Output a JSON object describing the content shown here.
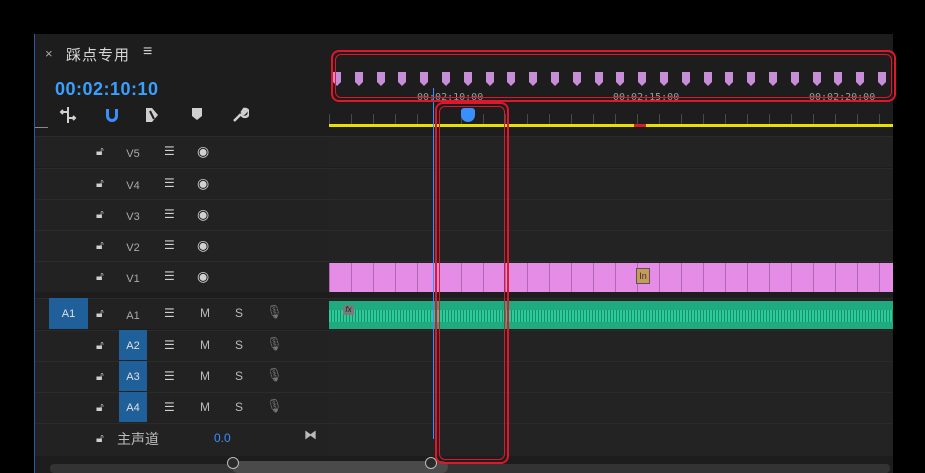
{
  "panel": {
    "close_icon": "×",
    "title": "踩点专用",
    "menu_icon": "≡",
    "timecode": "00:02:10:10"
  },
  "ruler": {
    "labels": [
      "00:02:10:00",
      "00:02:15:00",
      "00:02:20:00"
    ]
  },
  "tracks": {
    "video": [
      {
        "name": "V5"
      },
      {
        "name": "V4"
      },
      {
        "name": "V3"
      },
      {
        "name": "V2"
      },
      {
        "name": "V1"
      }
    ],
    "audio": [
      {
        "name": "A1",
        "source": "A1",
        "mute": "M",
        "solo": "S"
      },
      {
        "name": "A2",
        "mute": "M",
        "solo": "S"
      },
      {
        "name": "A3",
        "mute": "M",
        "solo": "S"
      },
      {
        "name": "A4",
        "mute": "M",
        "solo": "S"
      }
    ],
    "master": {
      "label": "主声道",
      "value": "0.0"
    }
  },
  "clip": {
    "fx_badge": "fx",
    "in_marker": "In"
  },
  "colors": {
    "accent": "#3a8fff",
    "video_clip": "#e48ce6",
    "audio_clip": "#1faa80",
    "work_area": "#e8e000",
    "annotation": "#e0162a"
  },
  "icons": [
    "close-icon",
    "menu-icon",
    "snap-insert-icon",
    "magnet-icon",
    "linked-selection-icon",
    "marker-icon",
    "wrench-icon",
    "lock-icon",
    "sync-icon",
    "eye-icon",
    "mic-icon",
    "playhead-icon"
  ]
}
